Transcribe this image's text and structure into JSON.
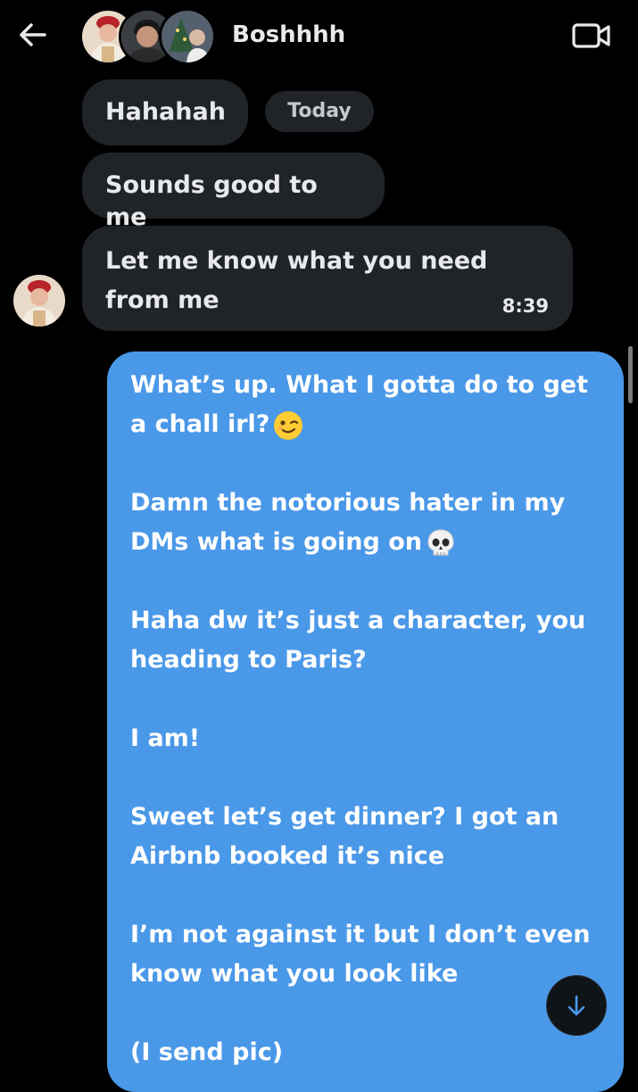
{
  "header": {
    "title": "Boshhhh",
    "back_icon": "arrow-left-icon",
    "video_icon": "video-camera-icon"
  },
  "date_pill": "Today",
  "received": [
    {
      "text": "Hahahah"
    },
    {
      "text": "Sounds good to me"
    },
    {
      "text": "Let me know what you need from me",
      "time": "8:39"
    }
  ],
  "sent": {
    "paragraphs": [
      {
        "text": "What’s up. What I gotta do to get a chall irl?",
        "emoji": "winking-face-emoji"
      },
      {
        "text": "Damn the notorious hater in my DMs what is going on",
        "emoji": "skull-emoji"
      },
      {
        "text": "Haha dw it’s just a character, you heading to Paris?"
      },
      {
        "text": "I am!"
      },
      {
        "text": "Sweet let’s get dinner? I got an Airbnb booked it’s nice"
      },
      {
        "text": "I’m not against it but I don’t even know what you look like"
      },
      {
        "text": "(I send pic)"
      }
    ]
  },
  "colors": {
    "background": "#000000",
    "received_bubble": "#202327",
    "sent_bubble": "#4a98e8",
    "text": "#e7e9ea"
  }
}
